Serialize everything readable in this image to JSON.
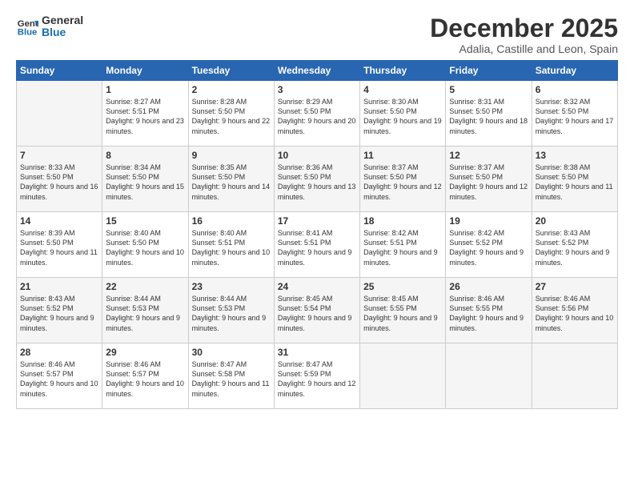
{
  "logo": {
    "line1": "General",
    "line2": "Blue"
  },
  "title": "December 2025",
  "subtitle": "Adalia, Castille and Leon, Spain",
  "header_days": [
    "Sunday",
    "Monday",
    "Tuesday",
    "Wednesday",
    "Thursday",
    "Friday",
    "Saturday"
  ],
  "weeks": [
    [
      {
        "day": "",
        "sunrise": "",
        "sunset": "",
        "daylight": ""
      },
      {
        "day": "1",
        "sunrise": "Sunrise: 8:27 AM",
        "sunset": "Sunset: 5:51 PM",
        "daylight": "Daylight: 9 hours and 23 minutes."
      },
      {
        "day": "2",
        "sunrise": "Sunrise: 8:28 AM",
        "sunset": "Sunset: 5:50 PM",
        "daylight": "Daylight: 9 hours and 22 minutes."
      },
      {
        "day": "3",
        "sunrise": "Sunrise: 8:29 AM",
        "sunset": "Sunset: 5:50 PM",
        "daylight": "Daylight: 9 hours and 20 minutes."
      },
      {
        "day": "4",
        "sunrise": "Sunrise: 8:30 AM",
        "sunset": "Sunset: 5:50 PM",
        "daylight": "Daylight: 9 hours and 19 minutes."
      },
      {
        "day": "5",
        "sunrise": "Sunrise: 8:31 AM",
        "sunset": "Sunset: 5:50 PM",
        "daylight": "Daylight: 9 hours and 18 minutes."
      },
      {
        "day": "6",
        "sunrise": "Sunrise: 8:32 AM",
        "sunset": "Sunset: 5:50 PM",
        "daylight": "Daylight: 9 hours and 17 minutes."
      }
    ],
    [
      {
        "day": "7",
        "sunrise": "Sunrise: 8:33 AM",
        "sunset": "Sunset: 5:50 PM",
        "daylight": "Daylight: 9 hours and 16 minutes."
      },
      {
        "day": "8",
        "sunrise": "Sunrise: 8:34 AM",
        "sunset": "Sunset: 5:50 PM",
        "daylight": "Daylight: 9 hours and 15 minutes."
      },
      {
        "day": "9",
        "sunrise": "Sunrise: 8:35 AM",
        "sunset": "Sunset: 5:50 PM",
        "daylight": "Daylight: 9 hours and 14 minutes."
      },
      {
        "day": "10",
        "sunrise": "Sunrise: 8:36 AM",
        "sunset": "Sunset: 5:50 PM",
        "daylight": "Daylight: 9 hours and 13 minutes."
      },
      {
        "day": "11",
        "sunrise": "Sunrise: 8:37 AM",
        "sunset": "Sunset: 5:50 PM",
        "daylight": "Daylight: 9 hours and 12 minutes."
      },
      {
        "day": "12",
        "sunrise": "Sunrise: 8:37 AM",
        "sunset": "Sunset: 5:50 PM",
        "daylight": "Daylight: 9 hours and 12 minutes."
      },
      {
        "day": "13",
        "sunrise": "Sunrise: 8:38 AM",
        "sunset": "Sunset: 5:50 PM",
        "daylight": "Daylight: 9 hours and 11 minutes."
      }
    ],
    [
      {
        "day": "14",
        "sunrise": "Sunrise: 8:39 AM",
        "sunset": "Sunset: 5:50 PM",
        "daylight": "Daylight: 9 hours and 11 minutes."
      },
      {
        "day": "15",
        "sunrise": "Sunrise: 8:40 AM",
        "sunset": "Sunset: 5:50 PM",
        "daylight": "Daylight: 9 hours and 10 minutes."
      },
      {
        "day": "16",
        "sunrise": "Sunrise: 8:40 AM",
        "sunset": "Sunset: 5:51 PM",
        "daylight": "Daylight: 9 hours and 10 minutes."
      },
      {
        "day": "17",
        "sunrise": "Sunrise: 8:41 AM",
        "sunset": "Sunset: 5:51 PM",
        "daylight": "Daylight: 9 hours and 9 minutes."
      },
      {
        "day": "18",
        "sunrise": "Sunrise: 8:42 AM",
        "sunset": "Sunset: 5:51 PM",
        "daylight": "Daylight: 9 hours and 9 minutes."
      },
      {
        "day": "19",
        "sunrise": "Sunrise: 8:42 AM",
        "sunset": "Sunset: 5:52 PM",
        "daylight": "Daylight: 9 hours and 9 minutes."
      },
      {
        "day": "20",
        "sunrise": "Sunrise: 8:43 AM",
        "sunset": "Sunset: 5:52 PM",
        "daylight": "Daylight: 9 hours and 9 minutes."
      }
    ],
    [
      {
        "day": "21",
        "sunrise": "Sunrise: 8:43 AM",
        "sunset": "Sunset: 5:52 PM",
        "daylight": "Daylight: 9 hours and 9 minutes."
      },
      {
        "day": "22",
        "sunrise": "Sunrise: 8:44 AM",
        "sunset": "Sunset: 5:53 PM",
        "daylight": "Daylight: 9 hours and 9 minutes."
      },
      {
        "day": "23",
        "sunrise": "Sunrise: 8:44 AM",
        "sunset": "Sunset: 5:53 PM",
        "daylight": "Daylight: 9 hours and 9 minutes."
      },
      {
        "day": "24",
        "sunrise": "Sunrise: 8:45 AM",
        "sunset": "Sunset: 5:54 PM",
        "daylight": "Daylight: 9 hours and 9 minutes."
      },
      {
        "day": "25",
        "sunrise": "Sunrise: 8:45 AM",
        "sunset": "Sunset: 5:55 PM",
        "daylight": "Daylight: 9 hours and 9 minutes."
      },
      {
        "day": "26",
        "sunrise": "Sunrise: 8:46 AM",
        "sunset": "Sunset: 5:55 PM",
        "daylight": "Daylight: 9 hours and 9 minutes."
      },
      {
        "day": "27",
        "sunrise": "Sunrise: 8:46 AM",
        "sunset": "Sunset: 5:56 PM",
        "daylight": "Daylight: 9 hours and 10 minutes."
      }
    ],
    [
      {
        "day": "28",
        "sunrise": "Sunrise: 8:46 AM",
        "sunset": "Sunset: 5:57 PM",
        "daylight": "Daylight: 9 hours and 10 minutes."
      },
      {
        "day": "29",
        "sunrise": "Sunrise: 8:46 AM",
        "sunset": "Sunset: 5:57 PM",
        "daylight": "Daylight: 9 hours and 10 minutes."
      },
      {
        "day": "30",
        "sunrise": "Sunrise: 8:47 AM",
        "sunset": "Sunset: 5:58 PM",
        "daylight": "Daylight: 9 hours and 11 minutes."
      },
      {
        "day": "31",
        "sunrise": "Sunrise: 8:47 AM",
        "sunset": "Sunset: 5:59 PM",
        "daylight": "Daylight: 9 hours and 12 minutes."
      },
      {
        "day": "",
        "sunrise": "",
        "sunset": "",
        "daylight": ""
      },
      {
        "day": "",
        "sunrise": "",
        "sunset": "",
        "daylight": ""
      },
      {
        "day": "",
        "sunrise": "",
        "sunset": "",
        "daylight": ""
      }
    ]
  ]
}
